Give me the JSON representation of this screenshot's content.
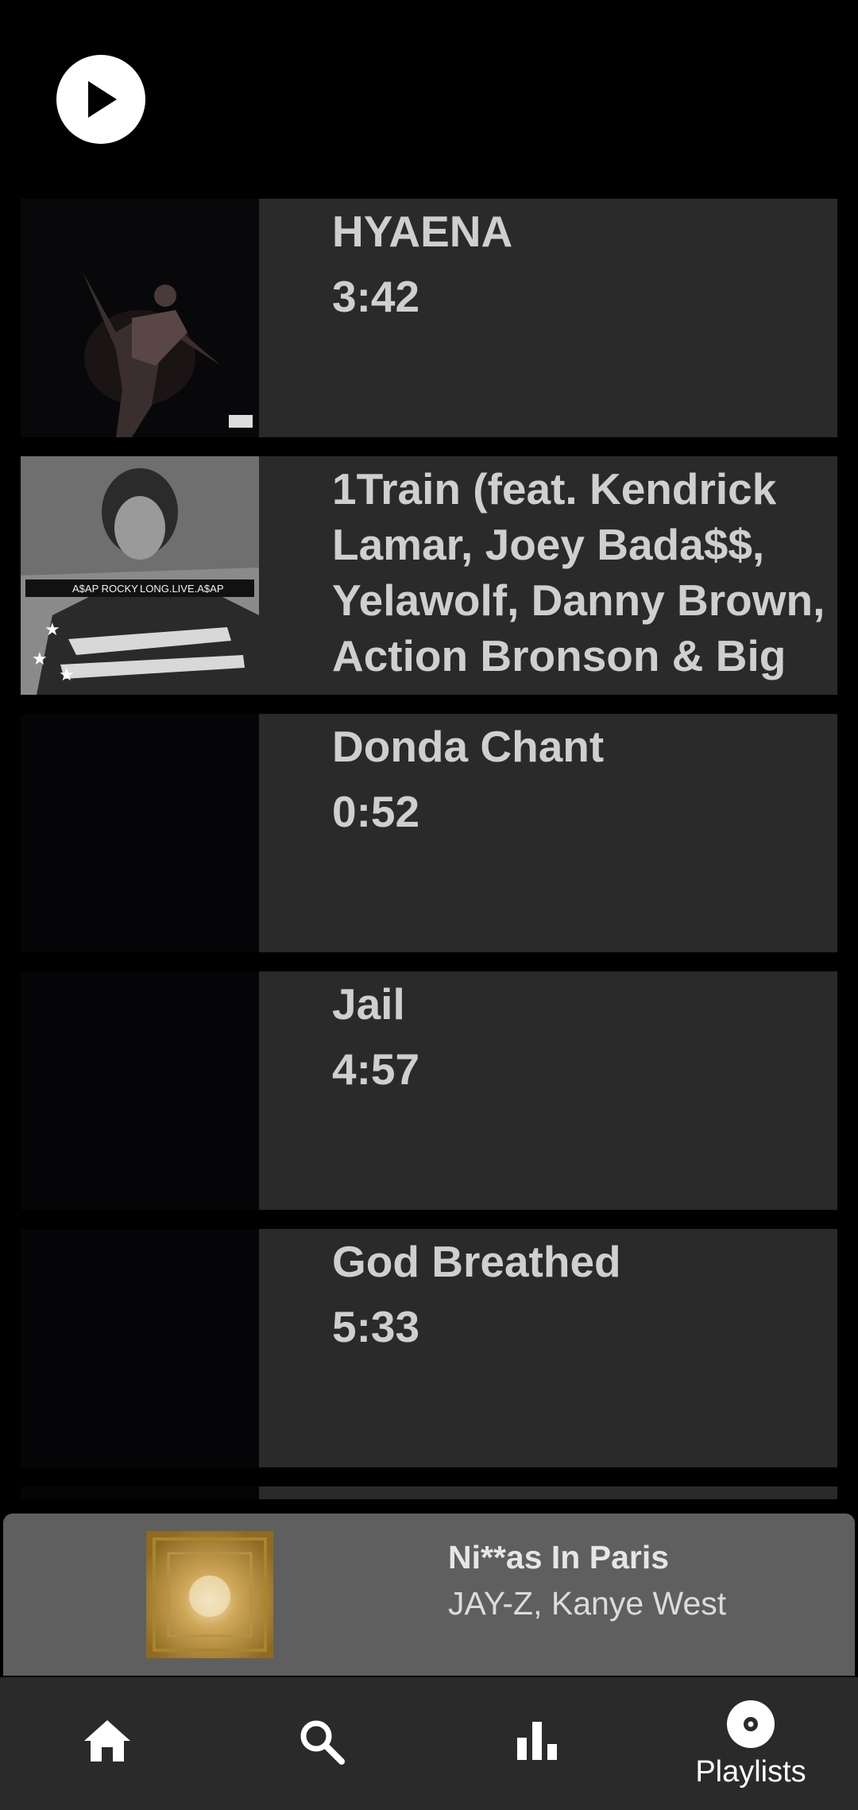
{
  "tracks": [
    {
      "title": "HYAENA",
      "duration": "3:42",
      "art": "dark-figure-cover"
    },
    {
      "title": "1Train (feat. Kendrick Lamar, Joey Bada$$, Yelawolf, Danny Brown, Action Bronson & Big",
      "duration": "",
      "art": "flag-cover",
      "art_text_left": "A$AP ROCKY",
      "art_text_right": "LONG.LIVE.A$AP"
    },
    {
      "title": "Donda Chant",
      "duration": "0:52",
      "art": "black-cover"
    },
    {
      "title": "Jail",
      "duration": "4:57",
      "art": "black-cover"
    },
    {
      "title": "God Breathed",
      "duration": "5:33",
      "art": "black-cover"
    }
  ],
  "now_playing": {
    "title": "Ni**as In Paris",
    "artist": "JAY-Z, Kanye West",
    "art": "gold-cover"
  },
  "nav": {
    "home": {
      "icon": "home-icon"
    },
    "search": {
      "icon": "search-icon"
    },
    "stats": {
      "icon": "bar-chart-icon"
    },
    "playlists": {
      "icon": "disc-icon",
      "label": "Playlists"
    }
  },
  "colors": {
    "background": "#000000",
    "row": "#2a2a2a",
    "text": "#cfcfcf",
    "mini_player": "#5f5f5f",
    "nav": "#2a2a2a"
  }
}
